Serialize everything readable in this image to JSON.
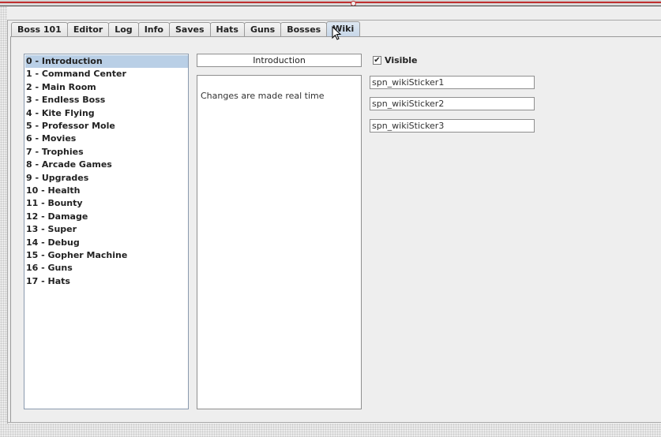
{
  "tabs": [
    {
      "label": "Boss 101"
    },
    {
      "label": "Editor"
    },
    {
      "label": "Log"
    },
    {
      "label": "Info"
    },
    {
      "label": "Saves"
    },
    {
      "label": "Hats"
    },
    {
      "label": "Guns"
    },
    {
      "label": "Bosses"
    },
    {
      "label": "Wiki",
      "active": true
    }
  ],
  "topics": [
    "0 - Introduction",
    "1 - Command Center",
    "2 - Main Room",
    "3 - Endless Boss",
    "4 - Kite Flying",
    "5 - Professor Mole",
    "6 - Movies",
    "7 - Trophies",
    "8 - Arcade Games",
    "9 - Upgrades",
    "10 - Health",
    "11 - Bounty",
    "12 - Damage",
    "13 - Super",
    "14 - Debug",
    "15 - Gopher Machine",
    "16 - Guns",
    "17 - Hats"
  ],
  "selected_topic_index": 0,
  "editor": {
    "title_value": "Introduction",
    "body_text": "Changes are made real time"
  },
  "visible": {
    "label": "Visible",
    "checked": true
  },
  "stickers": [
    "spn_wikiSticker1",
    "spn_wikiSticker2",
    "spn_wikiSticker3"
  ],
  "colors": {
    "selection": "#b9cfe6",
    "accent_line": "#c03030"
  }
}
